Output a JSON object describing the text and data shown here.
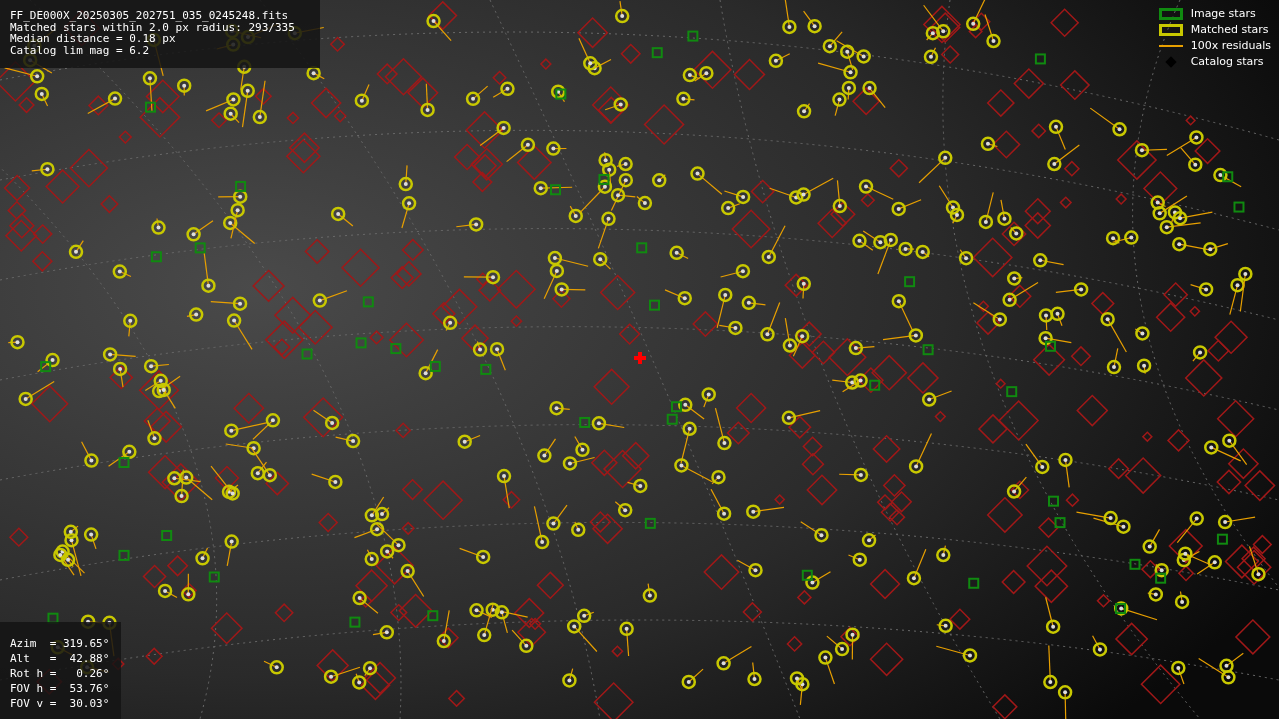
{
  "info_box": {
    "lines": [
      "FF_DE000X_20250305_202751_035_0245248.fits",
      "Matched stars within 2.0 px radius: 293/335",
      "Median distance = 0.18 px",
      "Catalog lim mag = 6.2"
    ]
  },
  "legend": [
    {
      "label": "Image stars",
      "kind": "box",
      "color": "#108a10"
    },
    {
      "label": "Matched stars",
      "kind": "box",
      "color": "#c8c800"
    },
    {
      "label": "100x residuals",
      "kind": "line",
      "color": "#e8a000"
    },
    {
      "label": "Catalog stars",
      "kind": "diamond",
      "color": "#000000"
    }
  ],
  "pointing_box": {
    "lines": [
      "Azim  = 319.65°",
      "Alt   =  42.88°",
      "Rot h =   0.26°",
      "FOV h =  53.76°",
      "FOV v =  30.03°"
    ]
  }
}
